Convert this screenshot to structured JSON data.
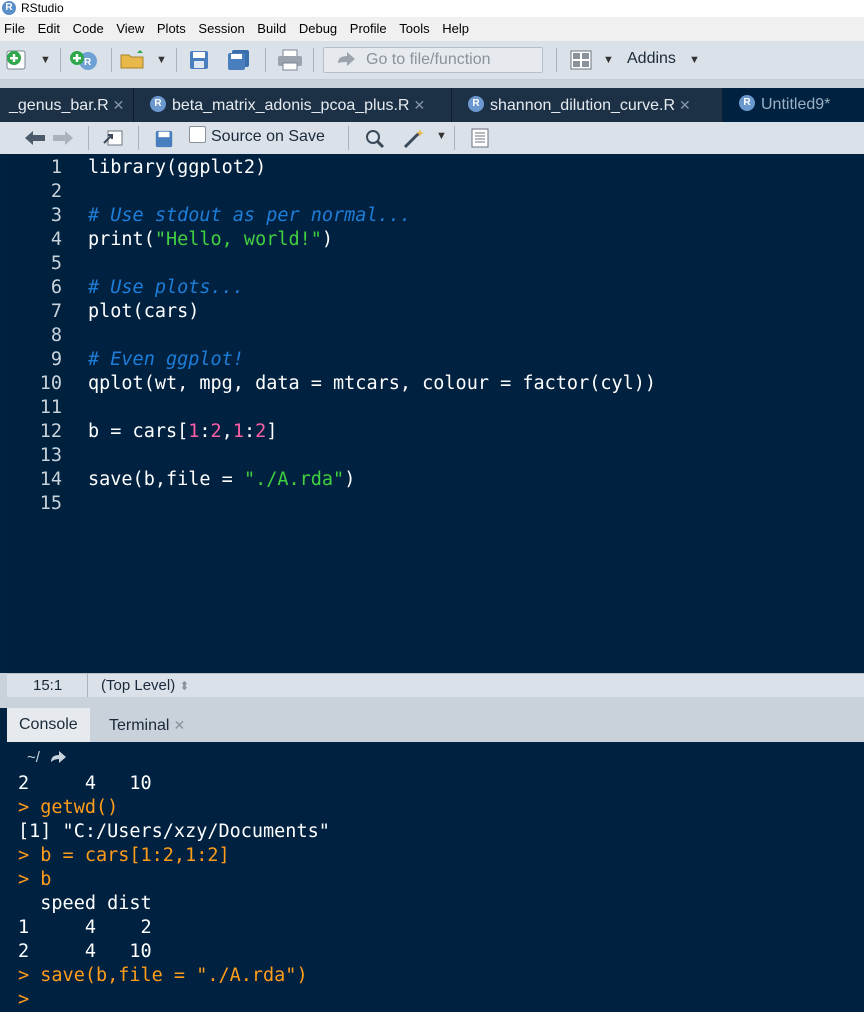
{
  "window": {
    "title": "RStudio"
  },
  "menu": [
    "File",
    "Edit",
    "Code",
    "View",
    "Plots",
    "Session",
    "Build",
    "Debug",
    "Profile",
    "Tools",
    "Help"
  ],
  "toolbar": {
    "goto_placeholder": "Go to file/function",
    "addins_label": "Addins"
  },
  "tabs": [
    {
      "label": "_genus_bar.R",
      "active": false
    },
    {
      "label": "beta_matrix_adonis_pcoa_plus.R",
      "active": false
    },
    {
      "label": "shannon_dilution_curve.R",
      "active": false
    },
    {
      "label": "Untitled9*",
      "active": true
    }
  ],
  "doc_toolbar": {
    "source_on_save": "Source on Save"
  },
  "editor": {
    "lines": [
      {
        "n": "1",
        "text": "library(ggplot2)"
      },
      {
        "n": "2",
        "text": ""
      },
      {
        "n": "3",
        "text": "# Use stdout as per normal..."
      },
      {
        "n": "4",
        "text": "print(\"Hello, world!\")"
      },
      {
        "n": "5",
        "text": ""
      },
      {
        "n": "6",
        "text": "# Use plots..."
      },
      {
        "n": "7",
        "text": "plot(cars)"
      },
      {
        "n": "8",
        "text": ""
      },
      {
        "n": "9",
        "text": "# Even ggplot!"
      },
      {
        "n": "10",
        "text": "qplot(wt, mpg, data = mtcars, colour = factor(cyl))"
      },
      {
        "n": "11",
        "text": ""
      },
      {
        "n": "12",
        "text": "b = cars[1:2,1:2]"
      },
      {
        "n": "13",
        "text": ""
      },
      {
        "n": "14",
        "text": "save(b,file = \"./A.rda\")"
      },
      {
        "n": "15",
        "text": ""
      }
    ]
  },
  "status": {
    "position": "15:1",
    "scope": "(Top Level)"
  },
  "console_tabs": [
    "Console",
    "Terminal"
  ],
  "console": {
    "cwd": "~/",
    "lines": [
      {
        "text": "2     4   10",
        "cmd": false
      },
      {
        "text": "> getwd()",
        "cmd": true
      },
      {
        "text": "[1] \"C:/Users/xzy/Documents\"",
        "cmd": false
      },
      {
        "text": "> b = cars[1:2,1:2]",
        "cmd": true
      },
      {
        "text": "> b",
        "cmd": true
      },
      {
        "text": "  speed dist",
        "cmd": false
      },
      {
        "text": "1     4    2",
        "cmd": false
      },
      {
        "text": "2     4   10",
        "cmd": false
      },
      {
        "text": "> save(b,file = \"./A.rda\")",
        "cmd": true
      },
      {
        "text": "> ",
        "cmd": true
      }
    ]
  },
  "colors": {
    "editor_bg": "#002240",
    "comment": "#1e7dd8",
    "string": "#40d040",
    "number": "#ff5fa6",
    "console_cmd": "#ff9d1a"
  }
}
